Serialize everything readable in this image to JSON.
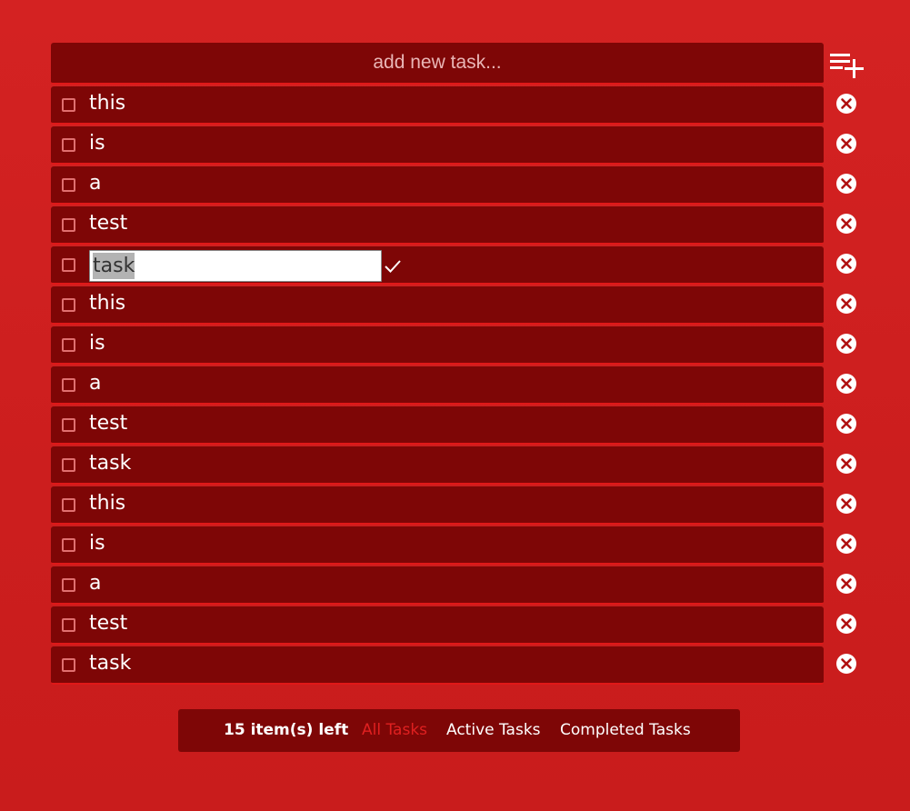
{
  "new_task": {
    "placeholder": "add new task..."
  },
  "tasks": [
    {
      "label": "this",
      "completed": false,
      "editing": false
    },
    {
      "label": "is",
      "completed": false,
      "editing": false
    },
    {
      "label": "a",
      "completed": false,
      "editing": false
    },
    {
      "label": "test",
      "completed": false,
      "editing": false
    },
    {
      "label": "task",
      "completed": false,
      "editing": true
    },
    {
      "label": "this",
      "completed": false,
      "editing": false
    },
    {
      "label": "is",
      "completed": false,
      "editing": false
    },
    {
      "label": "a",
      "completed": false,
      "editing": false
    },
    {
      "label": "test",
      "completed": false,
      "editing": false
    },
    {
      "label": "task",
      "completed": false,
      "editing": false
    },
    {
      "label": "this",
      "completed": false,
      "editing": false
    },
    {
      "label": "is",
      "completed": false,
      "editing": false
    },
    {
      "label": "a",
      "completed": false,
      "editing": false
    },
    {
      "label": "test",
      "completed": false,
      "editing": false
    },
    {
      "label": "task",
      "completed": false,
      "editing": false
    }
  ],
  "footer": {
    "items_left": "15 item(s) left",
    "filters": {
      "all": "All Tasks",
      "active": "Active Tasks",
      "completed": "Completed Tasks"
    },
    "active_filter": "all"
  },
  "icons": {
    "add": "playlist-add-icon",
    "delete": "close-circle-icon",
    "confirm": "check-icon",
    "checkbox": "checkbox-empty-icon"
  },
  "colors": {
    "background": "#d42222",
    "panel": "#7e0606",
    "row_border": "#e01818",
    "active_filter": "#e02020"
  }
}
